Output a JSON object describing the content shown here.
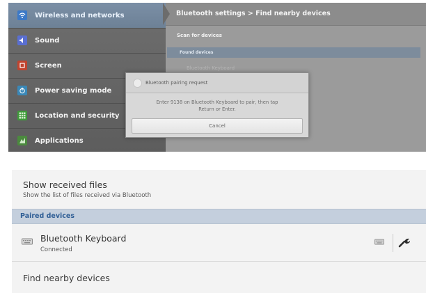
{
  "top_screen": {
    "sidebar": {
      "items": [
        {
          "label": "Wireless and networks",
          "icon": "wifi-icon",
          "active": true
        },
        {
          "label": "Sound",
          "icon": "speaker-icon",
          "active": false
        },
        {
          "label": "Screen",
          "icon": "screen-icon",
          "active": false
        },
        {
          "label": "Power saving mode",
          "icon": "power-icon",
          "active": false
        },
        {
          "label": "Location and security",
          "icon": "grid-lock-icon",
          "active": false
        },
        {
          "label": "Applications",
          "icon": "apps-icon",
          "active": false
        }
      ]
    },
    "breadcrumb": "Bluetooth settings > Find nearby devices",
    "scan_label": "Scan for devices",
    "found_devices_header": "Found devices",
    "found_device_ghost": "Bluetooth Keyboard",
    "dialog": {
      "title": "Bluetooth pairing request",
      "message_line1": "Enter 9138 on Bluetooth Keyboard to pair, then tap",
      "message_line2": "Return or Enter.",
      "cancel_label": "Cancel"
    },
    "colors": {
      "active_item": "#7b8fa6",
      "found_bar": "#7d8c9c"
    }
  },
  "bottom_screen": {
    "show_received": {
      "title": "Show received files",
      "subtitle": "Show the list of files received via Bluetooth"
    },
    "paired_header": "Paired devices",
    "device": {
      "name": "Bluetooth Keyboard",
      "status": "Connected",
      "icon": "keyboard-icon",
      "settings_icon": "wrench-icon"
    },
    "find_nearby": "Find nearby devices",
    "colors": {
      "paired_bar": "#c4cfdd",
      "paired_text": "#2f5e95"
    }
  }
}
